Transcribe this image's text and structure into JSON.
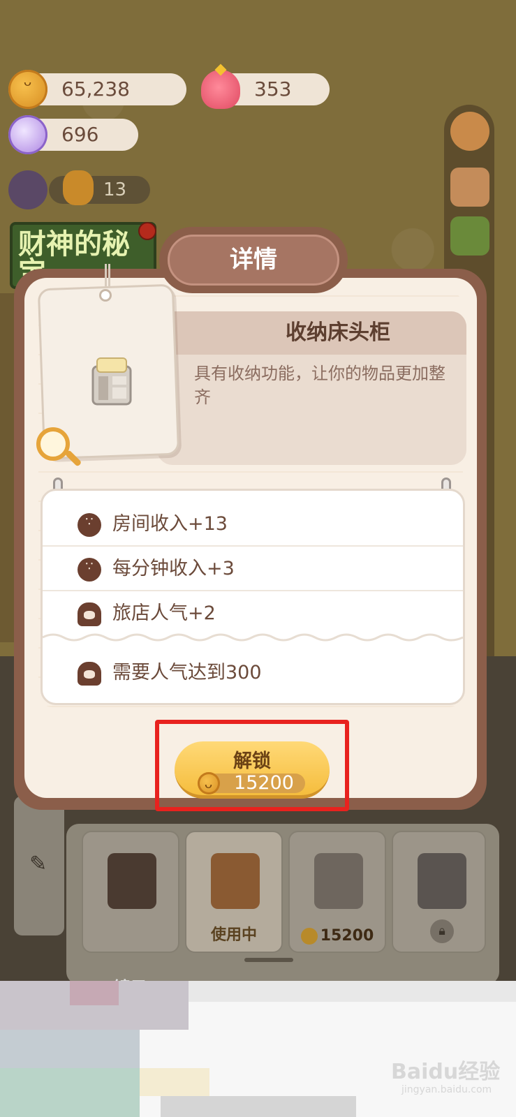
{
  "hud": {
    "coins": "65,238",
    "hearts": "353",
    "candy": "696",
    "level_value": "13"
  },
  "event_banner": {
    "label": "财神的秘宝"
  },
  "dialog": {
    "title": "详情",
    "item_name": "收纳床头柜",
    "item_description": "具有收纳功能，让你的物品更加整齐",
    "attributes": [
      {
        "icon": "cookie-icon",
        "text": "房间收入+13"
      },
      {
        "icon": "cookie-icon",
        "text": "每分钟收入+3"
      },
      {
        "icon": "crowd-icon",
        "text": "旅店人气+2"
      }
    ],
    "requirement": {
      "icon": "crowd-icon",
      "text": "需要人气达到300"
    },
    "unlock_button": {
      "label": "解锁",
      "price": "15200"
    }
  },
  "shop": {
    "items": [
      {
        "name": "lamp-nightstand",
        "status": ""
      },
      {
        "name": "drawer-nightstand",
        "status": "使用中"
      },
      {
        "name": "storage-nightstand",
        "status": "15200"
      },
      {
        "name": "dresser",
        "status": "locked"
      }
    ],
    "next_row_label": "▢镜子"
  },
  "watermark": {
    "text": "Baidu经验",
    "sub": "jingyan.baidu.com"
  },
  "colors": {
    "highlight": "#e8221e",
    "dialog_frame": "#8b5e4a",
    "button_gold": "#f5bd3d"
  }
}
